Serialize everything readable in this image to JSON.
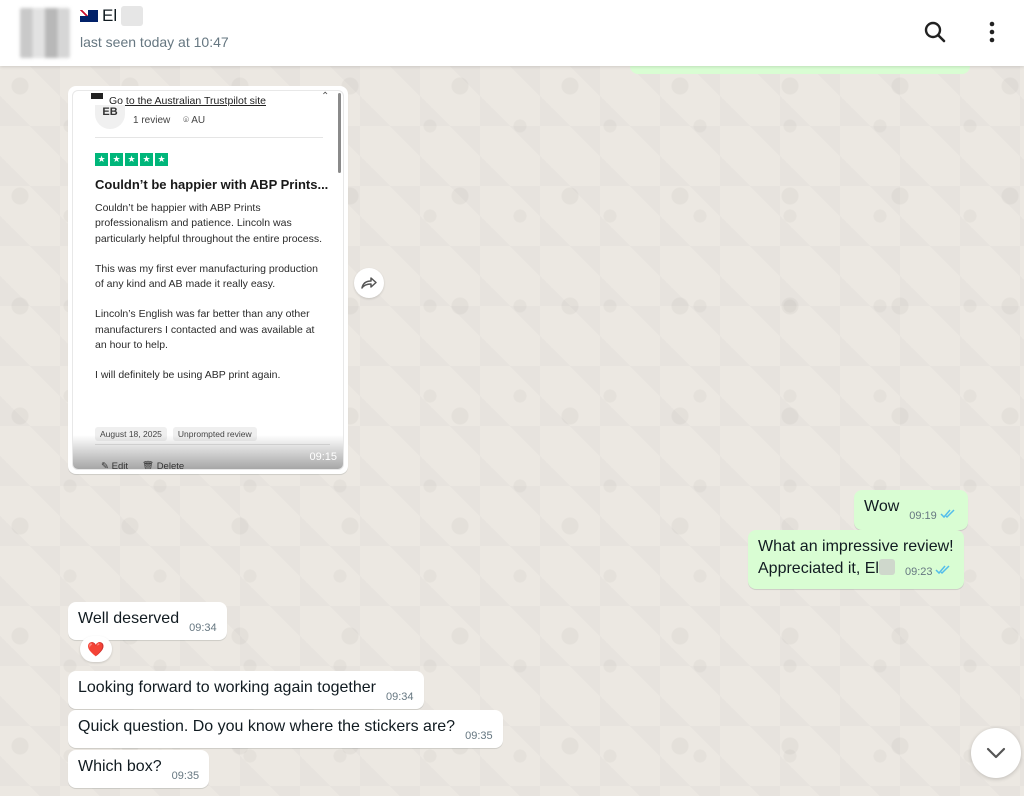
{
  "header": {
    "name_prefix": "El",
    "last_seen": "last seen today at 10:47",
    "icons": {
      "search": "search-icon",
      "menu": "kebab-menu-icon",
      "flag": "australia-flag-icon"
    }
  },
  "image_message": {
    "time": "09:15",
    "screenshot": {
      "link_text": "Go to the Australian Trustpilot site",
      "initials": "EB",
      "review_count": "1 review",
      "location": "AU",
      "rating": 5,
      "title": "Couldn’t be happier with ABP Prints...",
      "paragraphs": [
        "Couldn’t be happier with ABP Prints professionalism and patience. Lincoln was particularly helpful throughout the entire process.",
        "This was my first ever manufacturing production of any kind and AB made it really easy.",
        "Lincoln’s English was far better than any other manufacturers I contacted and was available at an hour to help.",
        "I will definitely be using ABP print again."
      ],
      "date_tag": "August 18, 2025",
      "type_tag": "Unprompted review",
      "edit_label": "Edit",
      "delete_label": "Delete"
    }
  },
  "messages": [
    {
      "id": "m1",
      "direction": "out",
      "text": "Wow",
      "time": "09:19",
      "status": "read"
    },
    {
      "id": "m2",
      "direction": "out",
      "line1": "What an impressive review!",
      "line2": "Appreciated it, El",
      "time": "09:23",
      "status": "read"
    },
    {
      "id": "m3",
      "direction": "in",
      "text": "Well deserved",
      "time": "09:34",
      "reaction": "❤️"
    },
    {
      "id": "m4",
      "direction": "in",
      "text": "Looking forward to working again together",
      "time": "09:34"
    },
    {
      "id": "m5",
      "direction": "in",
      "text": "Quick question. Do you know where the stickers are?",
      "time": "09:35"
    },
    {
      "id": "m6",
      "direction": "in",
      "text": "Which box?",
      "time": "09:35"
    }
  ],
  "colors": {
    "outgoing_bubble": "#d9fdd3",
    "incoming_bubble": "#ffffff",
    "read_ticks": "#53bdeb",
    "trustpilot_green": "#00b67a"
  }
}
